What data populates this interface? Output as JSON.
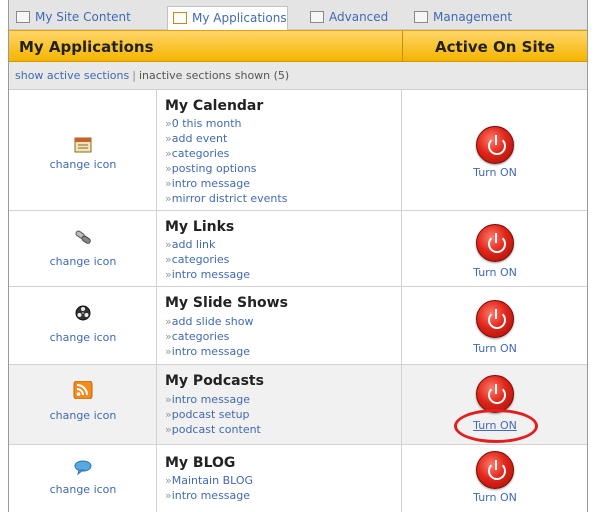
{
  "tabs": [
    {
      "label": "My Site Content",
      "icon": "site-content-icon"
    },
    {
      "label": "My Applications",
      "icon": "applications-icon"
    },
    {
      "label": "Advanced",
      "icon": "advanced-icon"
    },
    {
      "label": "Management",
      "icon": "management-icon"
    }
  ],
  "header": {
    "col1": "My Applications",
    "col2": "Active On Site"
  },
  "filter": {
    "active_link": "show active sections",
    "separator": "|",
    "inactive_text": "inactive sections shown (5)"
  },
  "apps": [
    {
      "icon": "calendar-icon",
      "change": "change icon",
      "title": "My Calendar",
      "links": [
        "0 this month",
        "add event",
        "categories",
        "posting options",
        "intro message",
        "mirror district events"
      ],
      "action": "Turn ON"
    },
    {
      "icon": "links-icon",
      "change": "change icon",
      "title": "My Links",
      "links": [
        "add link",
        "categories",
        "intro message"
      ],
      "action": "Turn ON"
    },
    {
      "icon": "slideshow-icon",
      "change": "change icon",
      "title": "My Slide Shows",
      "links": [
        "add slide show",
        "categories",
        "intro message"
      ],
      "action": "Turn ON"
    },
    {
      "icon": "rss-icon",
      "change": "change icon",
      "title": "My Podcasts",
      "links": [
        "intro message",
        "podcast setup",
        "podcast content"
      ],
      "action": "Turn ON"
    },
    {
      "icon": "blog-icon",
      "change": "change icon",
      "title": "My BLOG",
      "links": [
        "Maintain BLOG",
        "intro message"
      ],
      "action": "Turn ON"
    }
  ],
  "colors": {
    "header_gold": "#f6b400",
    "link_blue": "#4169b4",
    "power_red": "#e0261a",
    "highlight_circle": "#e21f1f"
  }
}
